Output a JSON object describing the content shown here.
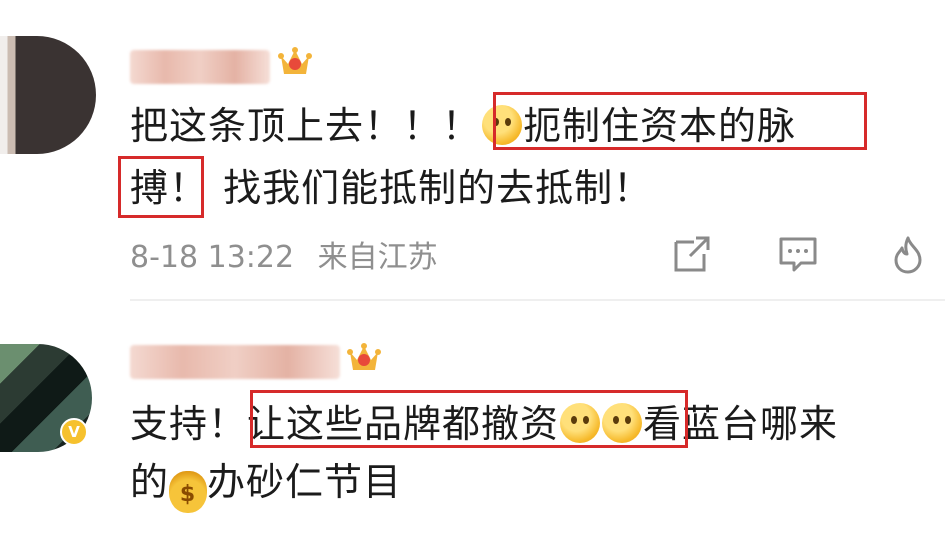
{
  "comments": [
    {
      "line1_prefix": "把这条顶上去！！！",
      "line1_boxed": "扼制住资本的脉",
      "line2_boxed": "搏！",
      "line2_rest": "找我们能抵制的去抵制！",
      "timestamp": "8-18 13:22",
      "location": "来自江苏",
      "actions": [
        "share-icon",
        "comment-icon",
        "like-icon"
      ]
    },
    {
      "line1_prefix": "支持！",
      "line1_boxed": "让这些品牌都撤资",
      "line1_rest": "看蓝台哪来",
      "line2_prefix": "的",
      "line2_rest": "办砂仁节目",
      "badge": "V"
    }
  ],
  "colors": {
    "highlight_box": "#d62a2a",
    "meta_text": "#8f8f8f",
    "badge": "#f6c12d"
  }
}
